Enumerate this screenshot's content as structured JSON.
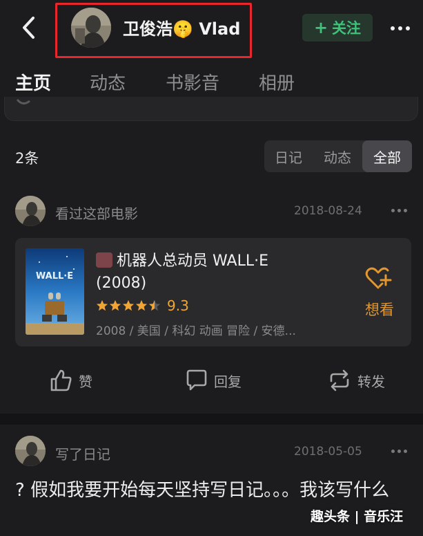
{
  "header": {
    "user_name": "卫俊浩🤫 Vlad",
    "follow_label": "关注",
    "follow_plus": "+"
  },
  "tabs": [
    "主页",
    "动态",
    "书影音",
    "相册"
  ],
  "section": {
    "count_label": "2条",
    "filters": [
      "日记",
      "动态",
      "全部"
    ],
    "active_filter": "全部"
  },
  "posts": [
    {
      "action": "看过这部电影",
      "date": "2018-08-24",
      "movie": {
        "title": "机器人总动员 WALL·E (2008)",
        "poster_text": "WALL·E",
        "rating": "9.3",
        "stars": 4.5,
        "meta": "2008 / 美国 / 科幻 动画 冒险 / 安德...",
        "want_label": "想看"
      }
    },
    {
      "action": "写了日记",
      "date": "2018-05-05",
      "text": "? 假如我要开始每天坚持写日记。。。我该写什么"
    }
  ],
  "actions": {
    "like": "赞",
    "reply": "回复",
    "repost": "转发"
  },
  "watermark": "趣头条 | 音乐汪",
  "colors": {
    "background": "#1c1c1e",
    "card": "#2a2a2d",
    "follow_green": "#3fc27a",
    "rating_orange": "#f0a534",
    "highlight_red": "#e8262c"
  }
}
